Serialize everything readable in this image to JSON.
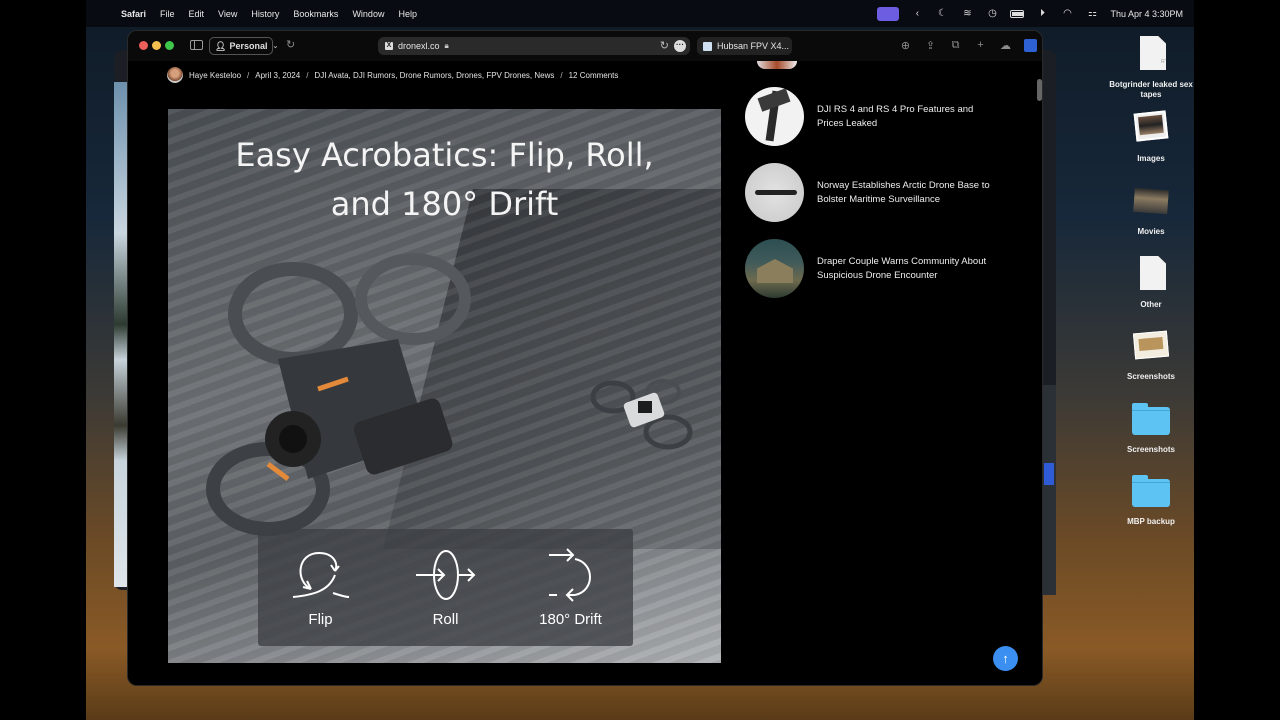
{
  "menubar": {
    "apple_icon": "apple-icon",
    "app_name": "Safari",
    "menus": [
      "File",
      "Edit",
      "View",
      "History",
      "Bookmarks",
      "Window",
      "Help"
    ],
    "status_icons": [
      "screen-share-icon",
      "chevron-left-icon",
      "moon-icon",
      "layers-icon",
      "time-machine-icon",
      "battery-icon",
      "play-icon",
      "wifi-icon",
      "control-center-icon"
    ],
    "clock": "Thu Apr 4  3:30PM"
  },
  "browser": {
    "profile_label": "Personal",
    "url": "dronexl.co",
    "other_tab_title": "Hubsan FPV X4...",
    "toolbar_icons": [
      "download-icon",
      "share-icon",
      "tab-overview-icon",
      "new-tab-icon",
      "icloud-icon",
      "extension-icon"
    ]
  },
  "article": {
    "author": "Haye Kesteloo",
    "date": "April 3, 2024",
    "categories": "DJI Avata, DJI Rumors, Drone Rumors, Drones, FPV Drones, News",
    "comments": "12 Comments",
    "separator": "/",
    "hero": {
      "headline_line1": "Easy Acrobatics: Flip, Roll,",
      "headline_line2": "and 180° Drift",
      "maneuvers": [
        {
          "label": "Flip",
          "icon": "flip-icon"
        },
        {
          "label": "Roll",
          "icon": "roll-icon"
        },
        {
          "label": "180° Drift",
          "icon": "drift-icon"
        }
      ]
    }
  },
  "related_posts": [
    {
      "title": "DJI RS 4 and RS 4 Pro Features and Prices Leaked"
    },
    {
      "title": "Norway Establishes Arctic Drone Base to Bolster Maritime Surveillance"
    },
    {
      "title": "Draper Couple Warns Community About Suspicious Drone Encounter"
    }
  ],
  "scroll_top_label": "↑",
  "desktop_items": [
    {
      "label": "Botgrinder leaked sex tapes",
      "type": "rtf-file",
      "badge": "RTF"
    },
    {
      "label": "Images",
      "type": "photo-stack"
    },
    {
      "label": "Movies",
      "type": "movie-stack"
    },
    {
      "label": "Other",
      "type": "document-stack"
    },
    {
      "label": "Screenshots",
      "type": "screenshot-stack"
    },
    {
      "label": "Screenshots",
      "type": "folder"
    },
    {
      "label": "MBP backup",
      "type": "folder"
    }
  ],
  "colors": {
    "accent_blue": "#3b8ff0",
    "folder_blue": "#5cc3f3",
    "traffic_red": "#ec5f5a",
    "traffic_yellow": "#f4bf4f",
    "traffic_green": "#3dc64a"
  }
}
